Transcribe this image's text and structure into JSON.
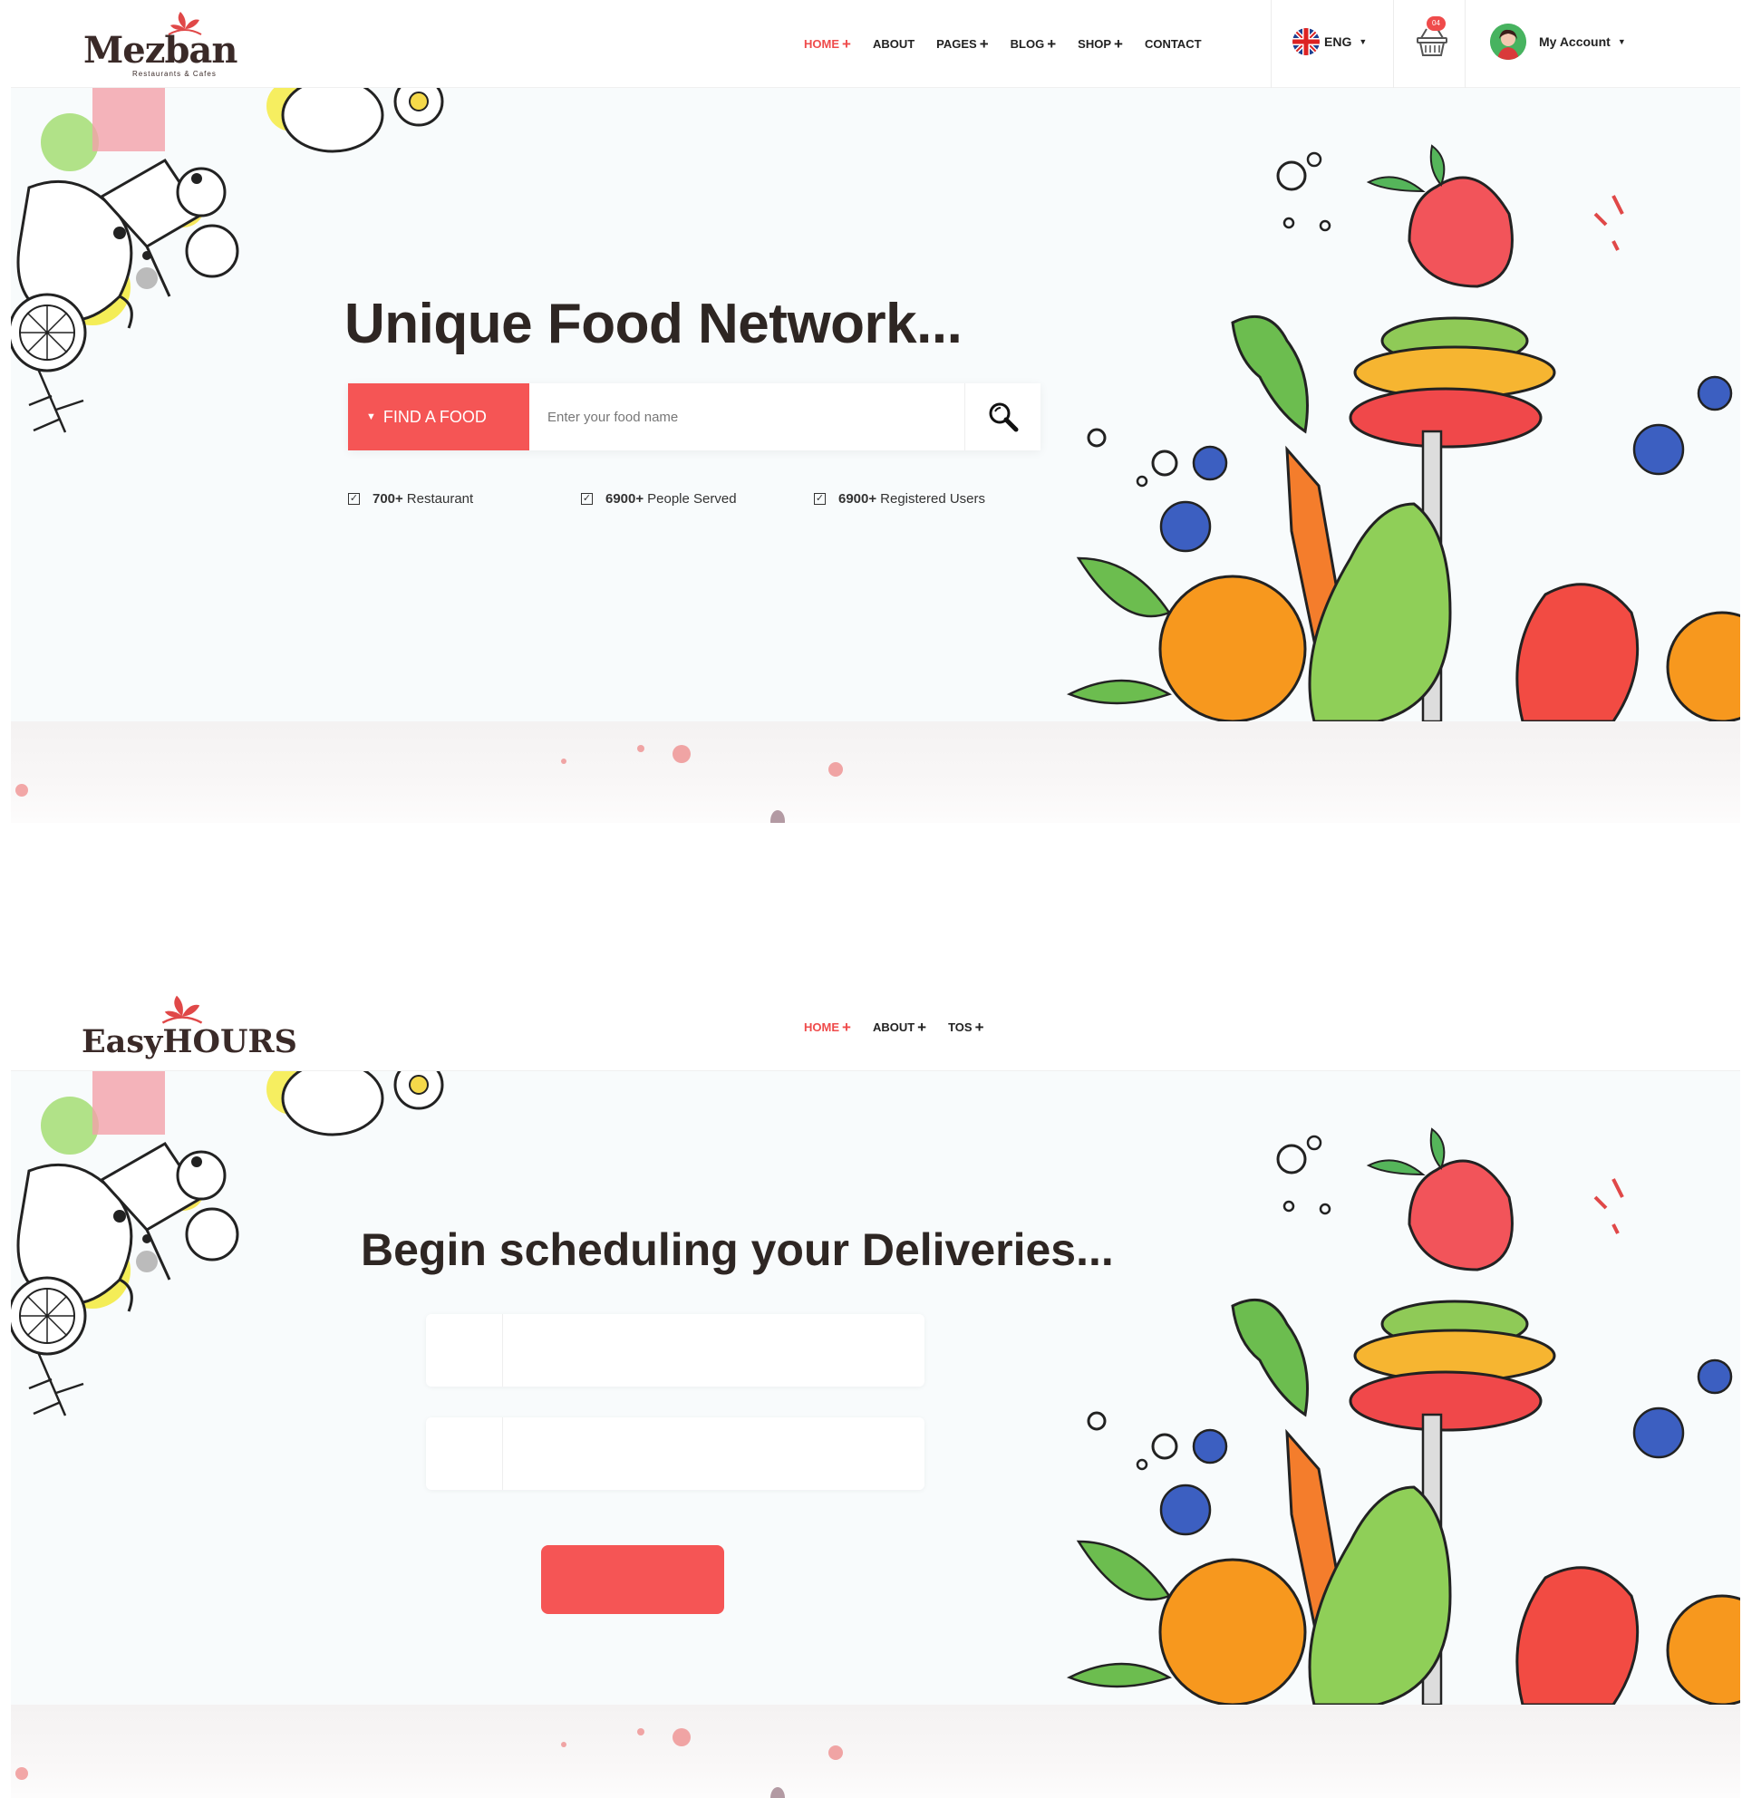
{
  "top": {
    "logo": {
      "name": "Mezban",
      "tagline": "Restaurants & Cafes"
    },
    "menu": [
      {
        "label": "HOME",
        "active": true,
        "has_plus": true
      },
      {
        "label": "ABOUT",
        "active": false,
        "has_plus": false
      },
      {
        "label": "PAGES",
        "active": false,
        "has_plus": true
      },
      {
        "label": "BLOG",
        "active": false,
        "has_plus": true
      },
      {
        "label": "SHOP",
        "active": false,
        "has_plus": true
      },
      {
        "label": "CONTACT",
        "active": false,
        "has_plus": false
      }
    ],
    "language": "ENG",
    "cart_count": "04",
    "account_label": "My Account",
    "hero": {
      "title": "Unique Food Network...",
      "find_button": "FIND A FOOD",
      "search_placeholder": "Enter your food name",
      "stats": [
        {
          "number": "700+",
          "label": "Restaurant"
        },
        {
          "number": "6900+",
          "label": "People Served"
        },
        {
          "number": "6900+",
          "label": "Registered Users"
        }
      ]
    }
  },
  "bottom": {
    "logo": {
      "name": "EasyHOURS"
    },
    "menu": [
      {
        "label": "HOME",
        "active": true,
        "has_plus": true
      },
      {
        "label": "ABOUT",
        "active": false,
        "has_plus": true
      },
      {
        "label": "TOS",
        "active": false,
        "has_plus": true
      }
    ],
    "hero": {
      "title": "Begin scheduling your Deliveries...",
      "field_1_value": "",
      "field_2_value": "",
      "submit_label": ""
    }
  },
  "colors": {
    "accent": "#f55555",
    "active_nav": "#ef4b4b",
    "title": "#2e2623",
    "hero_bg": "#f8fbfc"
  },
  "icons": [
    "uk-flag-icon",
    "basket-icon",
    "search-icon",
    "checkbox-icon",
    "logo-leaf-icon",
    "avatar-icon"
  ]
}
